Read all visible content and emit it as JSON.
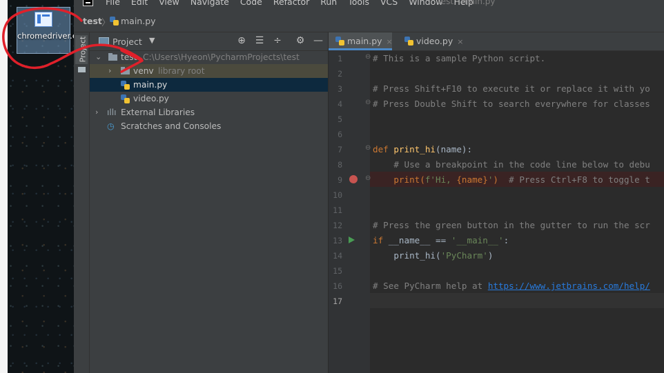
{
  "desktop": {
    "icon_label": "chromedriver.exe"
  },
  "menubar": {
    "items": [
      "File",
      "Edit",
      "View",
      "Navigate",
      "Code",
      "Refactor",
      "Run",
      "Tools",
      "VCS",
      "Window",
      "Help"
    ],
    "window_title": "test - main.py"
  },
  "navbar": {
    "project": "test",
    "file": "main.py"
  },
  "toolstrip": {
    "project_tab": "Project"
  },
  "project_panel": {
    "title": "Project",
    "tree": {
      "root_name": "test",
      "root_path": "C:\\Users\\Hyeon\\PycharmProjects\\test",
      "venv_name": "venv",
      "venv_note": "library root",
      "file1": "main.py",
      "file2": "video.py",
      "external": "External Libraries",
      "scratches": "Scratches and Consoles"
    }
  },
  "editor": {
    "tabs": [
      {
        "label": "main.py",
        "active": true
      },
      {
        "label": "video.py",
        "active": false
      }
    ],
    "lines": [
      "# This is a sample Python script.",
      "",
      "# Press Shift+F10 to execute it or replace it with yo",
      "# Press Double Shift to search everywhere for classes",
      "",
      "",
      "def print_hi(name):",
      "    # Use a breakpoint in the code line below to debu",
      "    print(f'Hi, {name}')  # Press Ctrl+F8 to toggle t",
      "",
      "",
      "# Press the green button in the gutter to run the scr",
      "if __name__ == '__main__':",
      "    print_hi('PyCharm')",
      "",
      "# See PyCharm help at https://www.jetbrains.com/help/",
      ""
    ],
    "tokens": {
      "l7_def": "def ",
      "l7_fn": "print_hi",
      "l7_rest": "(name):",
      "l9_call": "    print(",
      "l9_str1": "f'Hi, ",
      "l9_brace": "{name}",
      "l9_str2": "'",
      "l9_close": ")  ",
      "l9_cmt": "# Press Ctrl+F8 to toggle t",
      "l13_if": "if ",
      "l13_name": "__name__ == ",
      "l13_str": "'__main__'",
      "l13_colon": ":",
      "l14_call": "    print_hi(",
      "l14_str": "'PyCharm'",
      "l14_close": ")",
      "l16_text": "# See PyCharm help at ",
      "l16_link": "https://www.jetbrains.com/help/"
    },
    "breakpoint_line": 9,
    "run_marker_line": 13,
    "current_line": 17
  },
  "colors": {
    "accent": "#4a88c7",
    "breakpoint": "#c75450",
    "run": "#499c54",
    "annotation": "#e0202a"
  }
}
